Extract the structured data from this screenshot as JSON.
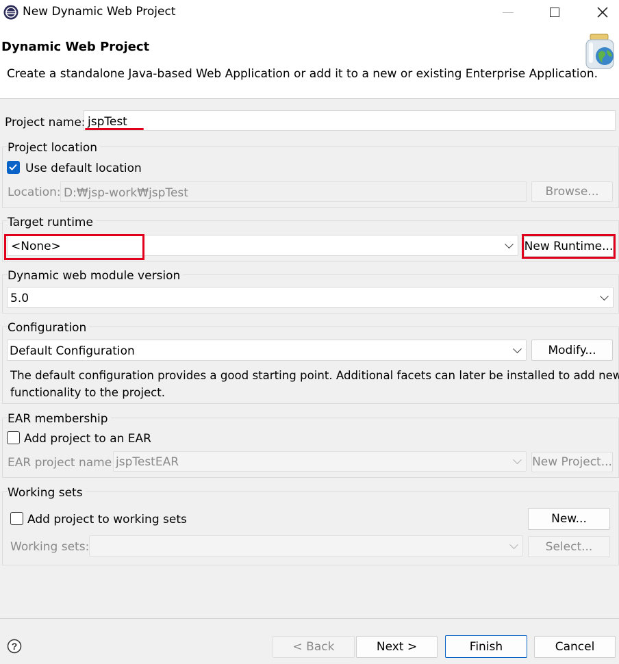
{
  "window": {
    "title": "New Dynamic Web Project"
  },
  "header": {
    "title": "Dynamic Web Project",
    "description": "Create a standalone Java-based Web Application or add it to a new or existing Enterprise Application."
  },
  "project_name": {
    "label": "Project name:",
    "value": "jspTest"
  },
  "project_location": {
    "group_label": "Project location",
    "use_default_label": "Use default location",
    "use_default_checked": true,
    "location_label": "Location:",
    "location_value": "D:₩jsp-work₩jspTest",
    "browse_label": "Browse..."
  },
  "target_runtime": {
    "group_label": "Target runtime",
    "selected": "<None>",
    "new_runtime_label": "New Runtime..."
  },
  "module_version": {
    "group_label": "Dynamic web module version",
    "selected": "5.0"
  },
  "configuration": {
    "group_label": "Configuration",
    "selected": "Default Configuration",
    "modify_label": "Modify...",
    "description_line1": "The default configuration provides a good starting point. Additional facets can later be installed to add new",
    "description_line2": "functionality to the project."
  },
  "ear": {
    "group_label": "EAR membership",
    "add_label": "Add project to an EAR",
    "add_checked": false,
    "name_label": "EAR project name:",
    "name_value": "jspTestEAR",
    "new_project_label": "New Project..."
  },
  "working_sets": {
    "group_label": "Working sets",
    "add_label": "Add project to working sets",
    "add_checked": false,
    "new_label": "New...",
    "sets_label": "Working sets:",
    "select_label": "Select..."
  },
  "footer": {
    "back_label": "< Back",
    "next_label": "Next >",
    "finish_label": "Finish",
    "cancel_label": "Cancel"
  },
  "colors": {
    "annotation_red": "#e0001b",
    "checkbox_blue": "#0a64c8",
    "default_button_border": "#0a64c8"
  }
}
